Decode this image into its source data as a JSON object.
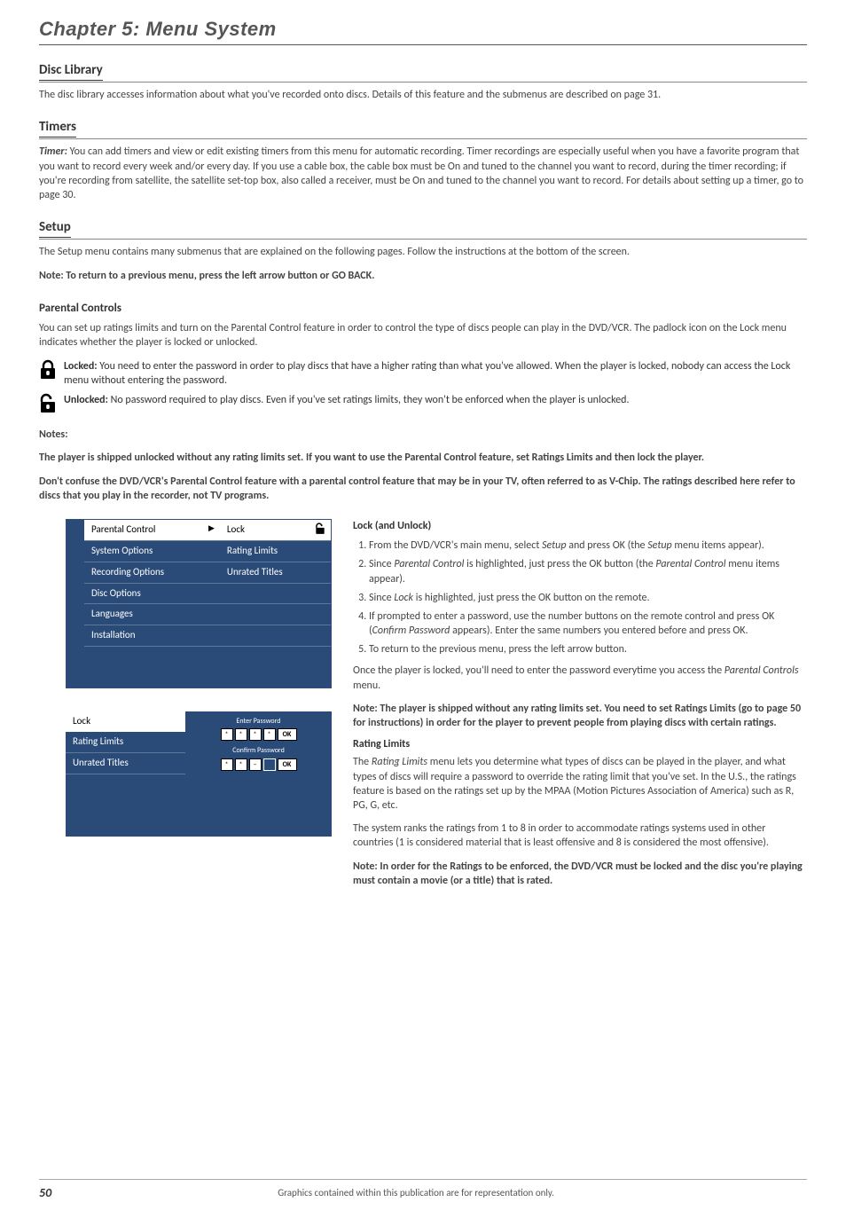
{
  "chapterTitle": "Chapter 5: Menu System",
  "discLibrary": {
    "heading": "Disc Library",
    "body": "The disc library accesses information about what you've recorded onto discs. Details of this feature and the submenus are described on page 31."
  },
  "timers": {
    "heading": "Timers",
    "leadLabel": "Timer:",
    "body": " You can add timers and view or edit existing timers from this menu for automatic recording. Timer recordings are especially useful when you have a favorite program that you want to record every week and/or every day. If you use a cable box, the cable box must be On and tuned to the channel you want to record, during the timer recording; if you're recording from satellite, the satellite set-top box, also called a receiver, must be On and tuned to the channel you want to record. For details about setting up a timer, go to page 30."
  },
  "setup": {
    "heading": "Setup",
    "body": "The Setup menu contains many submenus that are explained on the following pages. Follow the instructions at the bottom of the screen.",
    "note": "Note: To return to a previous menu, press the left arrow button or GO BACK."
  },
  "parental": {
    "heading": "Parental Controls",
    "intro": "You can set up ratings limits and turn on the Parental Control feature in order to control the type of discs people can play in the DVD/VCR. The padlock icon on the Lock menu indicates whether the player is locked or unlocked.",
    "lockedLabel": "Locked:",
    "lockedBody": " You need to enter the password in order to play discs that have a higher rating than what you've allowed. When the player is locked, nobody can access the Lock menu without entering the password.",
    "unlockedLabel": "Unlocked:",
    "unlockedBody": " No password required to play discs. Even if you've set ratings limits, they won't be enforced when the player is unlocked."
  },
  "notes": {
    "label": "Notes:",
    "line1": "The player is shipped unlocked without any rating limits set. If you want to use the Parental Control feature, set Ratings Limits and then lock the player.",
    "line2": "Don't confuse the DVD/VCR's Parental Control feature with a parental control feature that may be in your TV, often referred to as V-Chip. The ratings described here refer to discs that you play in the recorder, not TV programs."
  },
  "menu1": {
    "left": [
      "Parental Control",
      "System Options",
      "Recording Options",
      "Disc Options",
      "Languages",
      "Installation"
    ],
    "right": [
      "Lock",
      "Rating Limits",
      "Unrated Titles"
    ]
  },
  "menu2": {
    "left": [
      "Lock",
      "Rating Limits",
      "Unrated Titles"
    ],
    "enterPassword": "Enter Password",
    "confirmPassword": "Confirm Password",
    "ok": "OK"
  },
  "lockUnlock": {
    "heading": "Lock (and Unlock)",
    "steps": [
      {
        "pre": "From the DVD/VCR's main menu, select ",
        "em": "Setup",
        "mid": " and press OK (the ",
        "em2": "Setup",
        "post": " menu items appear)."
      },
      {
        "pre": "Since ",
        "em": "Parental Control",
        "mid": " is highlighted, just press the OK button (the ",
        "em2": "Parental Control",
        "post": " menu items appear)."
      },
      {
        "pre": "Since ",
        "em": "Lock",
        "mid": " is highlighted, just press the OK button on the remote.",
        "em2": "",
        "post": ""
      },
      {
        "pre": "If prompted to enter a password, use the number buttons on the remote control and press OK (",
        "em": "Confirm Password",
        "mid": " appears). Enter the same numbers you entered before and press OK.",
        "em2": "",
        "post": ""
      },
      {
        "pre": "To return to the previous menu, press the left arrow button.",
        "em": "",
        "mid": "",
        "em2": "",
        "post": ""
      }
    ],
    "afterSteps1a": "Once the player is locked, you'll need to enter the password everytime you access the ",
    "afterSteps1em": "Parental Controls",
    "afterSteps1b": " menu.",
    "noteBold": "Note: The player is shipped without any rating limits set. You need to set Ratings Limits (go to page 50 for instructions) in order for the player to prevent people from playing discs with certain ratings."
  },
  "ratingLimits": {
    "heading": "Rating Limits",
    "p1a": "The ",
    "p1em": "Rating Limits",
    "p1b": " menu lets you determine what types of discs can be played in the player, and what types of discs will require a password to override the rating limit that you've set. In the U.S., the ratings feature is based on the ratings set up by the MPAA (Motion Pictures Association of America) such as R, PG, G, etc.",
    "p2": "The system ranks the ratings from 1 to 8 in order to accommodate ratings systems used in other countries (1 is considered material that is least offensive and 8 is considered the most offensive).",
    "noteBold": "Note: In order for the Ratings to be enforced, the DVD/VCR must be locked and the disc you're playing must contain a movie (or a title) that is rated."
  },
  "footer": {
    "page": "50",
    "caption": "Graphics contained within this publication are for representation only."
  }
}
